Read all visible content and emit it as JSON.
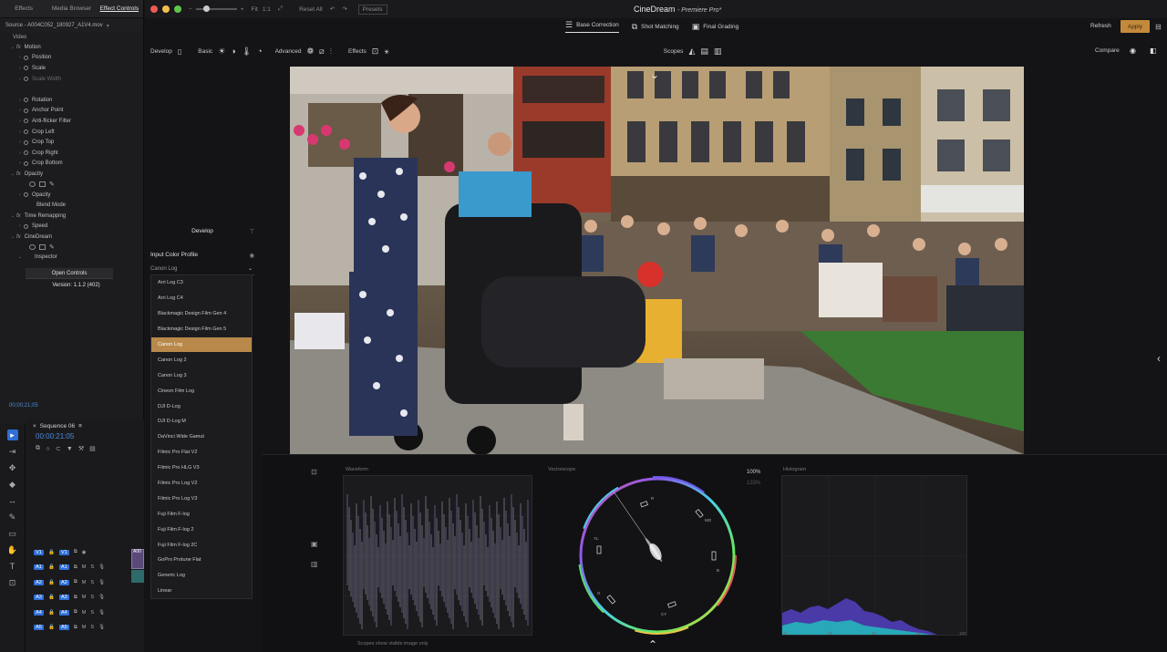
{
  "premiere": {
    "tabs": [
      "Effects",
      "Media Browser",
      "Effect Controls"
    ],
    "source": "Source - A004C052_180927_A1V4.mov",
    "video_label": "Video",
    "effect_rows": [
      {
        "label": "Motion",
        "fx": true
      },
      {
        "label": "Position"
      },
      {
        "label": "Scale"
      },
      {
        "label": "Scale Width",
        "dim": true
      },
      {
        "label": "",
        "spacer": true
      },
      {
        "label": "Rotation"
      },
      {
        "label": "Anchor Point"
      },
      {
        "label": "Anti-flicker Filter"
      },
      {
        "label": "Crop Left"
      },
      {
        "label": "Crop Top"
      },
      {
        "label": "Crop Right"
      },
      {
        "label": "Crop Bottom"
      },
      {
        "label": "Opacity",
        "fx": true
      },
      {
        "label": "",
        "shapes": true
      },
      {
        "label": "Opacity"
      },
      {
        "label": "Blend Mode"
      },
      {
        "label": "Time Remapping",
        "fx": true
      },
      {
        "label": "Speed"
      },
      {
        "label": "CineDream",
        "fx": true
      },
      {
        "label": "",
        "shapes": true
      },
      {
        "label": "Inspector"
      }
    ],
    "open_controls": "Open Controls",
    "version": "Version: 1.1.2 (402)",
    "timecode": "00;00;21;05",
    "sequence": {
      "title": "Sequence 06",
      "timecode": "00:00:21:05",
      "clip_label": "A00",
      "tracks": [
        {
          "a": "V1",
          "b": "V1",
          "kind": "video"
        },
        {
          "a": "A1",
          "b": "A1",
          "kind": "audio"
        },
        {
          "a": "A2",
          "b": "A2",
          "kind": "audio"
        },
        {
          "a": "A3",
          "b": "A3",
          "kind": "audio"
        },
        {
          "a": "A4",
          "b": "A4",
          "kind": "audio"
        },
        {
          "a": "A5",
          "b": "A5",
          "kind": "audio"
        }
      ]
    }
  },
  "cinedream": {
    "title": "CineDream",
    "title_suffix": "- Premiere Pro*",
    "fit_label": "Fit",
    "ratio_label": "1:1",
    "reset_all": "Reset All",
    "presets": "Presets",
    "modes": [
      {
        "label": "Base Correction",
        "active": true
      },
      {
        "label": "Shot Matching",
        "active": false
      },
      {
        "label": "Final Grading",
        "active": false
      }
    ],
    "refresh": "Refresh",
    "apply": "Apply",
    "toolbar": {
      "develop": "Develop",
      "basic": "Basic",
      "advanced": "Advanced",
      "effects": "Effects",
      "scopes": "Scopes",
      "compare": "Compare"
    },
    "develop_panel": {
      "title": "Develop",
      "input_color_profile": "Input Color Profile",
      "selected": "Canon Log",
      "options": [
        "Arri Log C3",
        "Arri Log C4",
        "Blackmagic Design Film Gen 4",
        "Blackmagic Design Film Gen 5",
        "Canon Log",
        "Canon Log 2",
        "Canon Log 3",
        "Cineon Film Log",
        "DJI D-Log",
        "DJI D-Log M",
        "DaVinci Wide Gamut",
        "Filmic Pro Flat V2",
        "Filmic Pro HLG V3",
        "Filmic Pro Log V2",
        "Filmic Pro Log V3",
        "Fuji Film F-log",
        "Fuji Film F-log 2",
        "Fuji Film F-log 2C",
        "GoPro Protune Flat",
        "Generic Log",
        "Linear"
      ]
    },
    "scopes": {
      "waveform": "Waveform",
      "vectorscope": "Vectorscope",
      "histogram": "Histogram",
      "vector_zoom_a": "100%",
      "vector_zoom_b": "133%",
      "vector_labels": [
        "R",
        "MG",
        "B",
        "CY",
        "G",
        "YL"
      ],
      "hist_ticks": [
        "0",
        "25",
        "50",
        "75",
        "100"
      ],
      "caption": "Scopes show visible image only"
    }
  },
  "colors": {
    "accent": "#c48a3c",
    "selection": "#b8894a",
    "premiere_blue": "#2f6fd6",
    "timecode_blue": "#4d8ad8"
  }
}
